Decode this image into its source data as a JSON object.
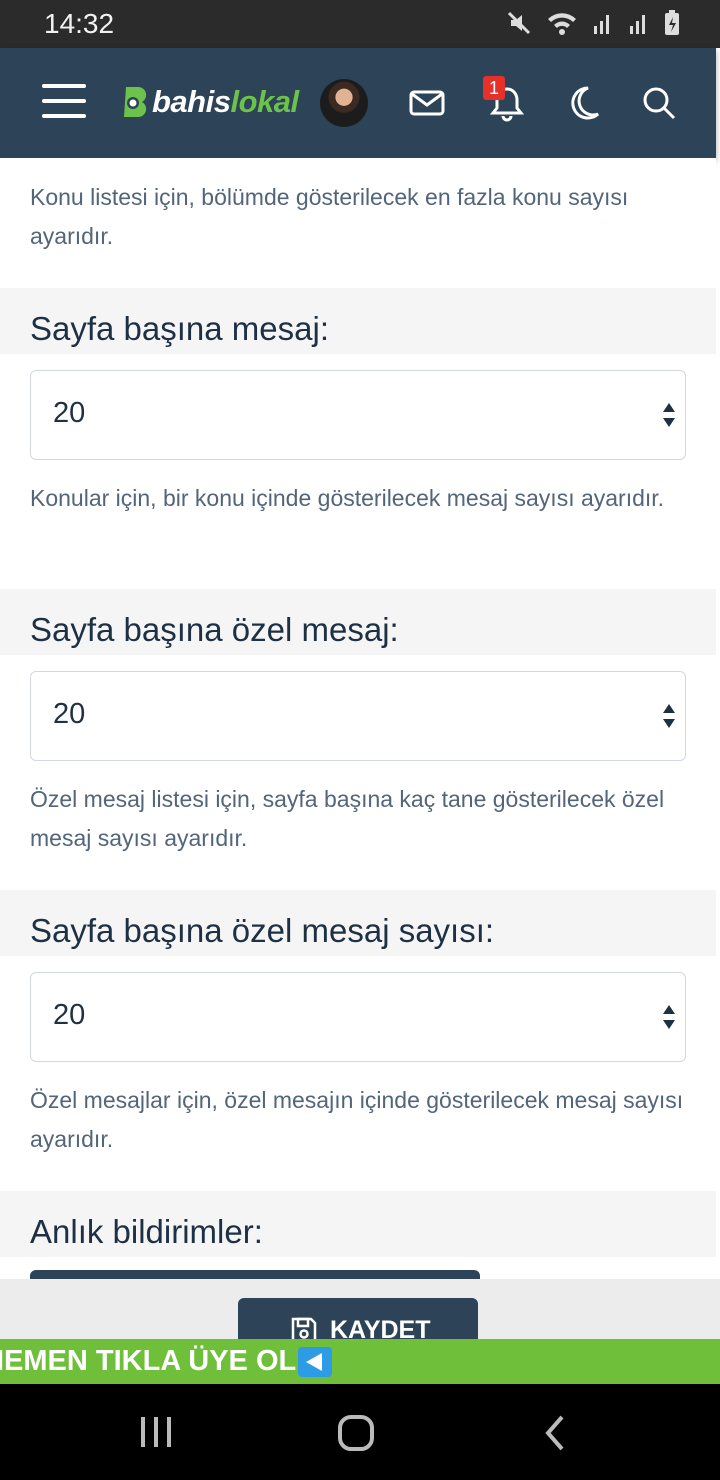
{
  "status_bar": {
    "time": "14:32",
    "icons": [
      "mute-icon",
      "wifi-icon",
      "signal-icon",
      "signal-icon",
      "battery-charging-icon"
    ]
  },
  "header": {
    "logo_prefix": "bahis",
    "logo_suffix": "lokal",
    "notification_count": "1",
    "icons": [
      "menu-icon",
      "envelope-icon",
      "bell-icon",
      "moon-icon",
      "search-icon"
    ],
    "colors": {
      "header_bg": "#2d4358",
      "brand_green": "#6cc24a"
    }
  },
  "sections": {
    "top_description": "Konu listesi için, bölümde gösterilecek en fazla konu sayısı ayarıdır.",
    "messages_per_page": {
      "label": "Sayfa başına mesaj:",
      "value": "20",
      "description": "Konular için, bir konu içinde gösterilecek mesaj sayısı ayarıdır."
    },
    "private_messages_per_page": {
      "label": "Sayfa başına özel mesaj:",
      "value": "20",
      "description": "Özel mesaj listesi için, sayfa başına kaç tane gösterilecek özel mesaj sayısı ayarıdır."
    },
    "private_message_count_per_page": {
      "label": "Sayfa başına özel mesaj sayısı:",
      "value": "20",
      "description": "Özel mesajlar için, özel mesajın içinde gösterilecek mesaj sayısı ayarıdır."
    },
    "instant_notifications": {
      "label": "Anlık bildirimler:"
    }
  },
  "save_button": {
    "label": "KAYDET"
  },
  "promo_banner": {
    "text": "IEMEN TIKLA ÜYE OL",
    "color": "#6fbf3b"
  }
}
